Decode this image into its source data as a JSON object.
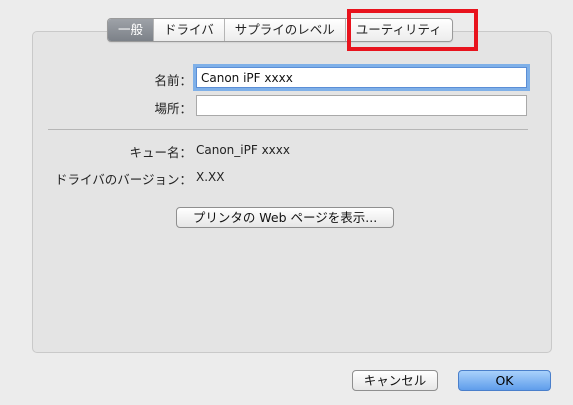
{
  "tabs": [
    {
      "label": "一般",
      "active": true
    },
    {
      "label": "ドライバ",
      "active": false
    },
    {
      "label": "サプライのレベル",
      "active": false
    },
    {
      "label": "ユーティリティ",
      "active": false
    }
  ],
  "form": {
    "name_label": "名前：",
    "name_value": "Canon iPF xxxx",
    "location_label": "場所：",
    "location_value": ""
  },
  "info": {
    "queue_label": "キュー名：",
    "queue_value": "Canon_iPF xxxx",
    "driver_label": "ドライバのバージョン：",
    "driver_value": "X.XX"
  },
  "buttons": {
    "web_page": "プリンタの Web ページを表示...",
    "cancel": "キャンセル",
    "ok": "OK"
  },
  "colors": {
    "highlight": "#e8131d",
    "ok_button": "#5f9deb"
  }
}
